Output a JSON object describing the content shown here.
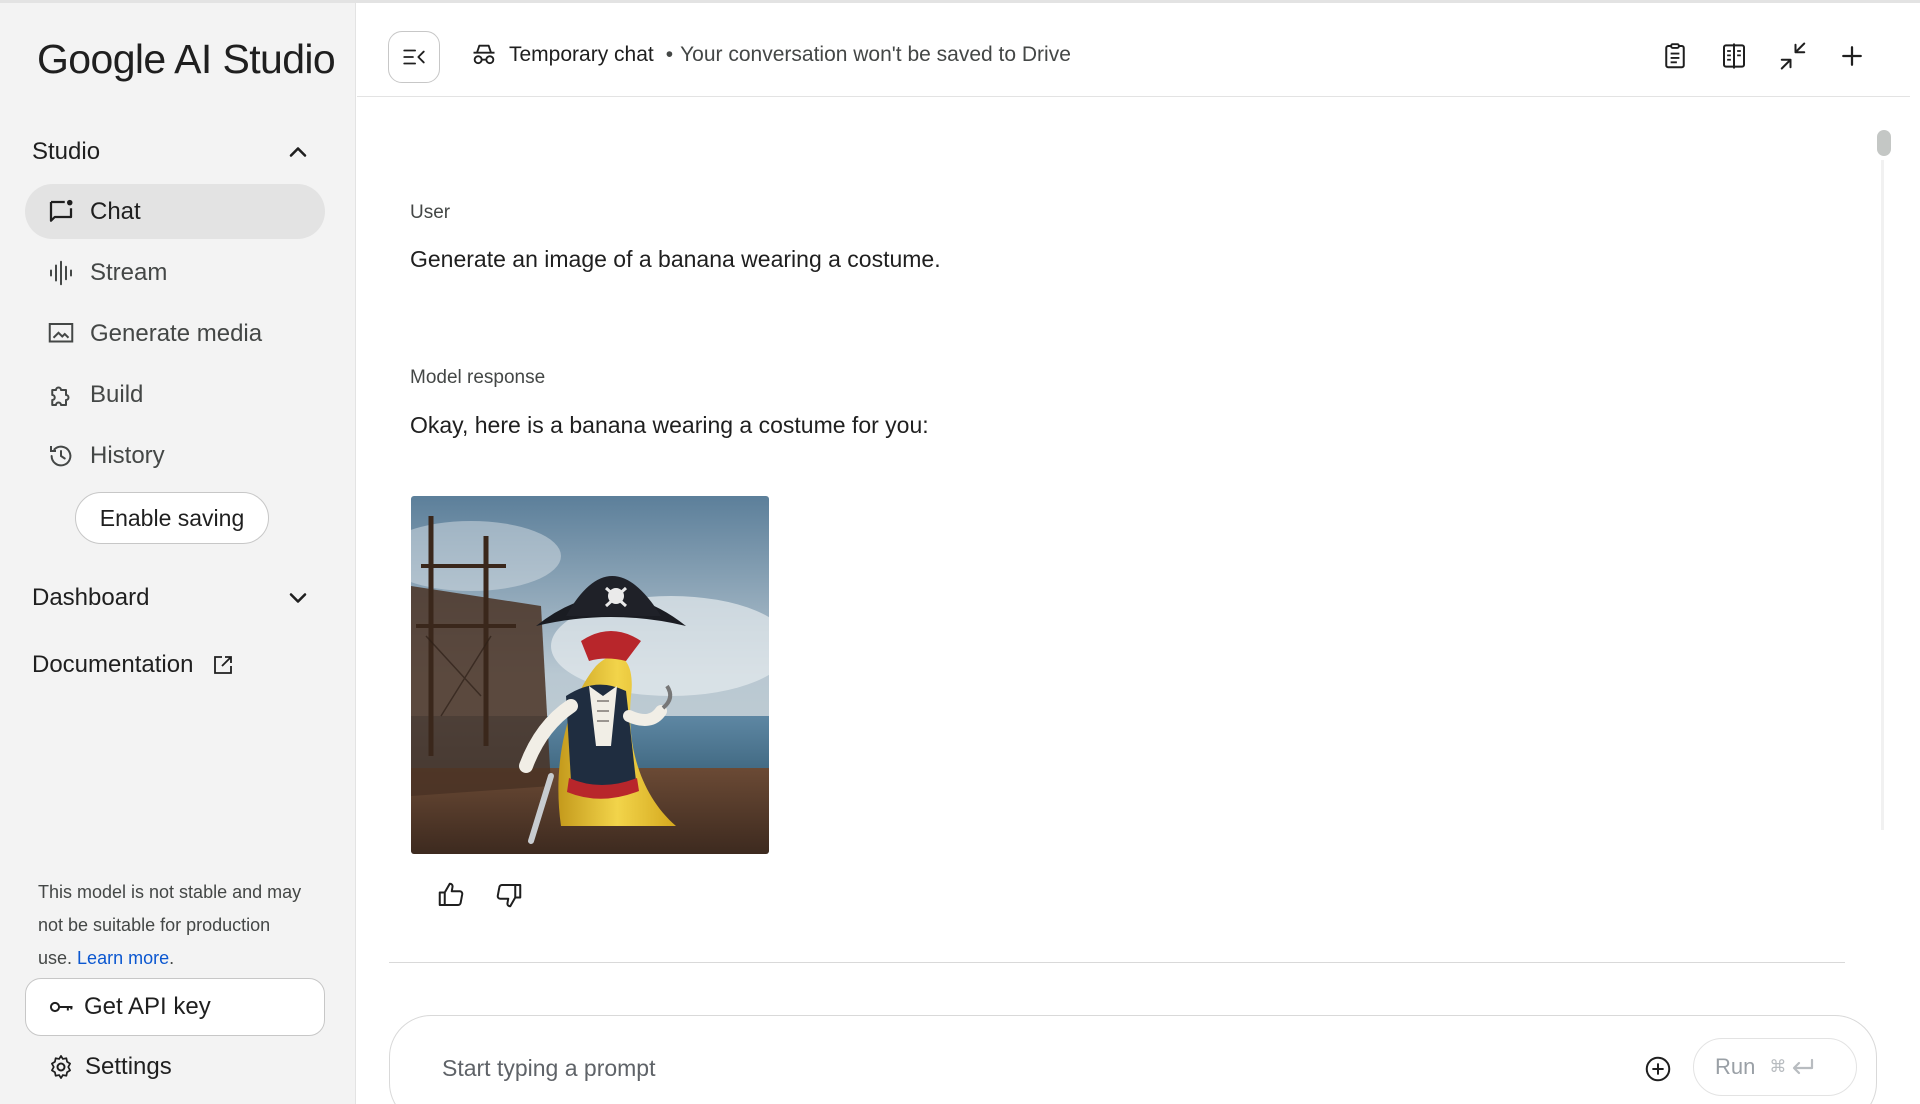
{
  "app": {
    "logo_text": "Google AI Studio"
  },
  "sidebar": {
    "studio_label": "Studio",
    "items": [
      {
        "label": "Chat",
        "icon": "chat-icon",
        "active": true
      },
      {
        "label": "Stream",
        "icon": "waveform-icon"
      },
      {
        "label": "Generate media",
        "icon": "image-icon"
      },
      {
        "label": "Build",
        "icon": "puzzle-icon"
      },
      {
        "label": "History",
        "icon": "history-icon"
      }
    ],
    "enable_saving_label": "Enable saving",
    "dashboard_label": "Dashboard",
    "documentation_label": "Documentation",
    "notice_text": "This model is not stable and may not be suitable for production use.",
    "notice_link": "Learn more",
    "notice_end": ".",
    "api_key_label": "Get API key",
    "settings_label": "Settings"
  },
  "header": {
    "title": "Temporary chat",
    "separator": "•",
    "subtitle": "Your conversation won't be saved to Drive",
    "icons": [
      "clipboard-icon",
      "compare-icon",
      "collapse-icon",
      "plus-icon"
    ]
  },
  "conversation": {
    "user_role": "User",
    "user_message": "Generate an image of a banana wearing a costume.",
    "model_role": "Model response",
    "model_message": "Okay, here is a banana wearing a costume for you:",
    "image_subject": "banana in pirate costume"
  },
  "prompt": {
    "placeholder": "Start typing a prompt",
    "run_label": "Run",
    "shortcut": "⌘"
  },
  "colors": {
    "sidebar_bg": "#f3f3f3",
    "active_item_bg": "#e3e3e3",
    "link": "#0b57d0",
    "border": "#c7c7c7"
  }
}
